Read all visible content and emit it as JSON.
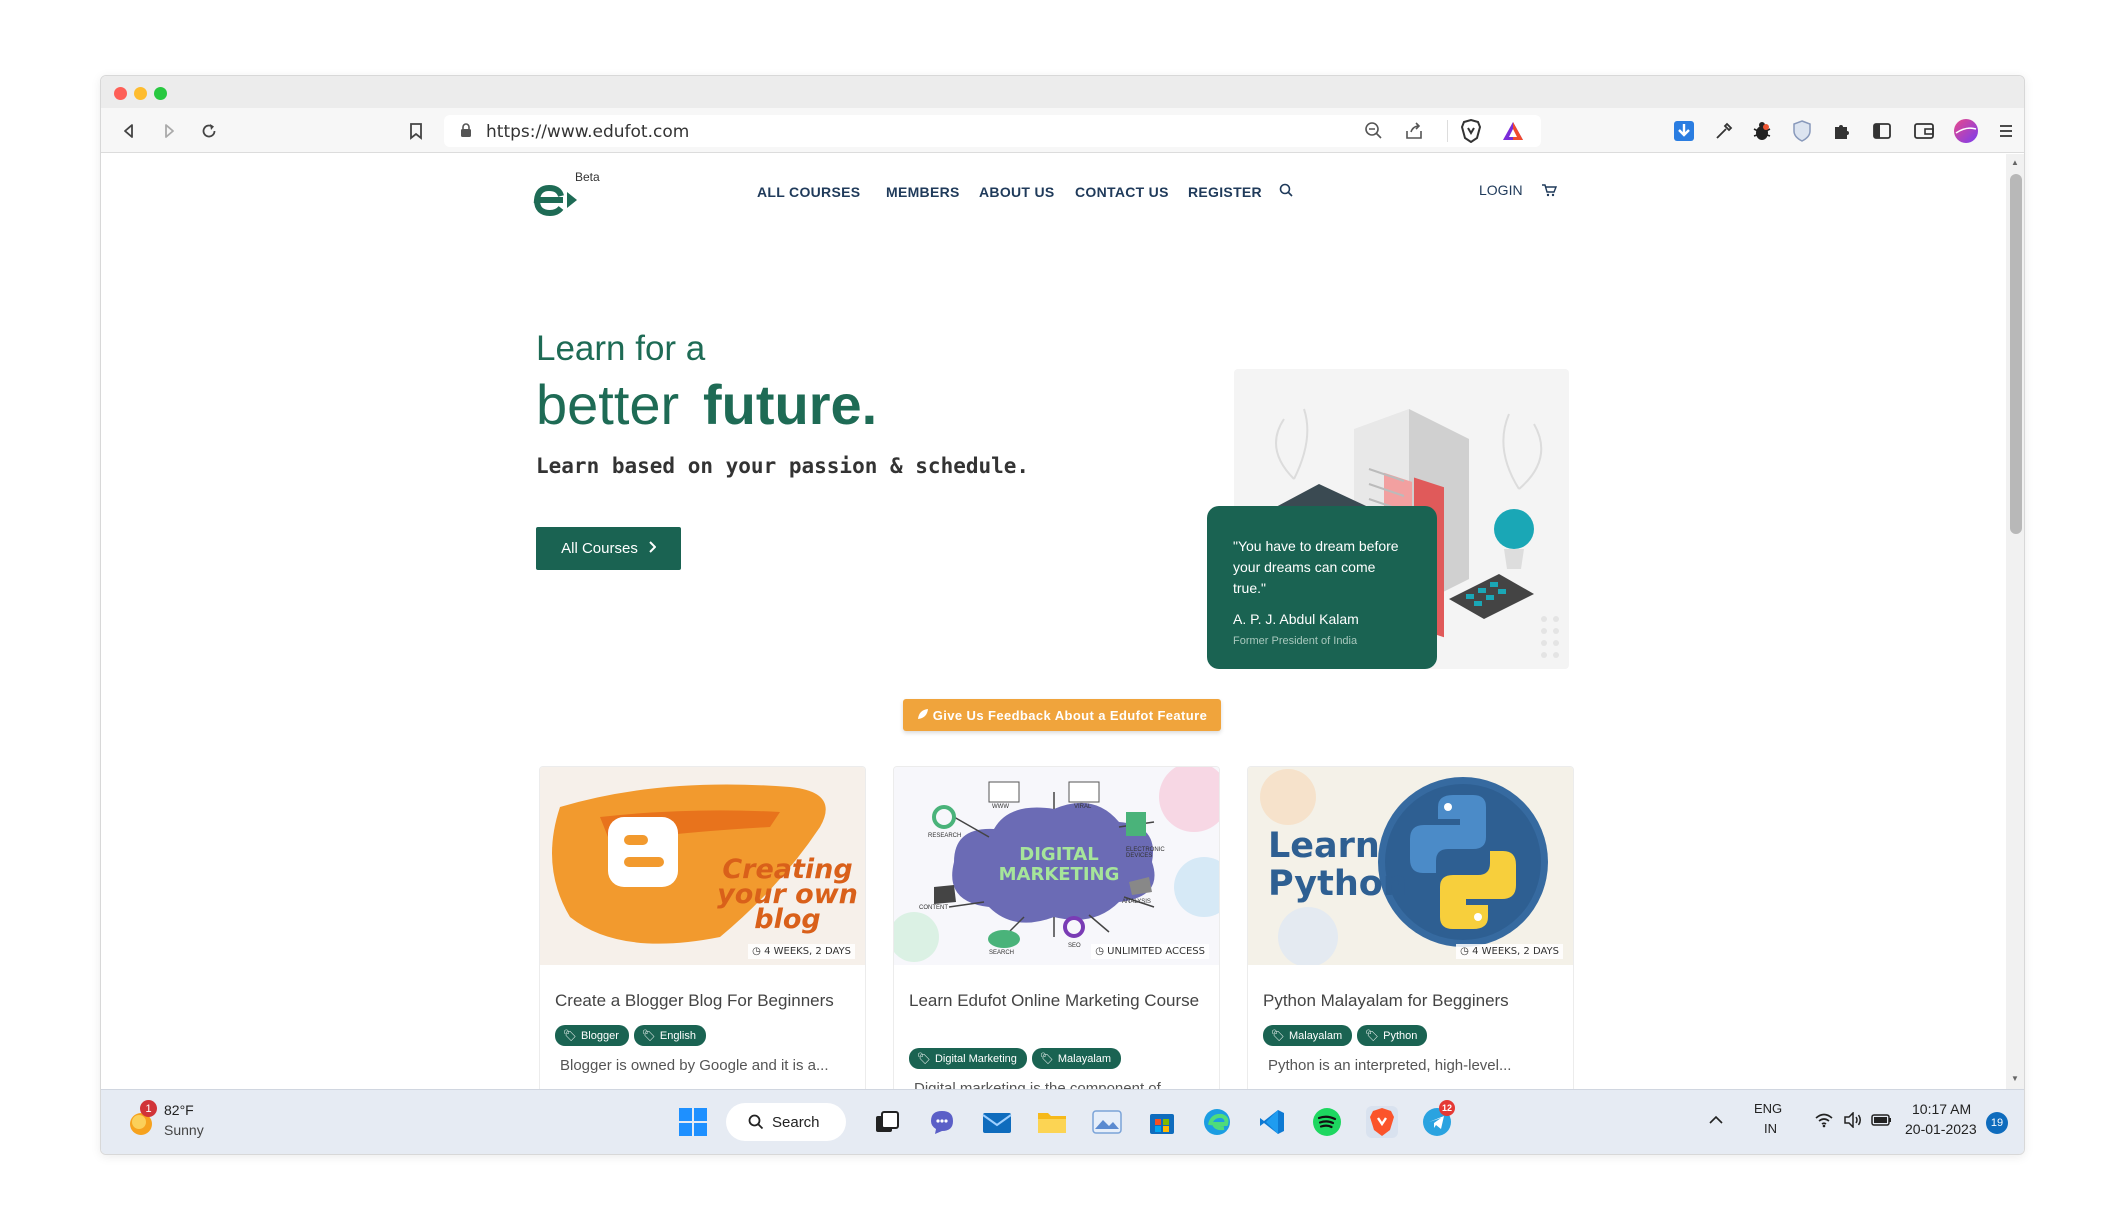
{
  "browser": {
    "url": "https://www.edufot.com"
  },
  "site": {
    "logo_badge": "Beta",
    "nav": [
      {
        "label": "ALL COURSES"
      },
      {
        "label": "MEMBERS"
      },
      {
        "label": "ABOUT US"
      },
      {
        "label": "CONTACT US"
      },
      {
        "label": "REGISTER"
      }
    ],
    "login": "LOGIN"
  },
  "hero": {
    "line1": "Learn for a",
    "line2_light": "better",
    "line2_bold": "future.",
    "subtitle": "Learn based on your passion & schedule.",
    "button": "All Courses"
  },
  "quote": {
    "text": "\"You have to dream before your dreams can come true.\"",
    "author": "A. P. J. Abdul Kalam",
    "role": "Former President of India"
  },
  "feedback": {
    "label": "Give Us Feedback About a Edufot Feature"
  },
  "courses": [
    {
      "image_text": "Creating your own blog",
      "duration": "4 WEEKS, 2 DAYS",
      "title": "Create a Blogger Blog For Beginners",
      "tags": [
        "Blogger",
        "English"
      ],
      "desc": "Blogger is owned by Google and it is a..."
    },
    {
      "image_text": "DIGITAL MARKETING",
      "image_labels": [
        "RESEARCH",
        "WWW",
        "VIRAL",
        "ELECTRONIC DEVICES",
        "CONTENT",
        "ANALYSIS",
        "SEARCH",
        "SEO"
      ],
      "duration": "UNLIMITED ACCESS",
      "title": "Learn Edufot Online Marketing Course",
      "tags": [
        "Digital Marketing",
        "Malayalam"
      ],
      "desc": "Digital marketing is the component of..."
    },
    {
      "image_text": "Learn Python",
      "duration": "4 WEEKS, 2 DAYS",
      "title": "Python Malayalam for Begginers",
      "tags": [
        "Malayalam",
        "Python"
      ],
      "desc": "Python is an interpreted, high-level..."
    }
  ],
  "taskbar": {
    "weather_temp": "82°F",
    "weather_cond": "Sunny",
    "weather_badge": "1",
    "search": "Search",
    "lang1": "ENG",
    "lang2": "IN",
    "time": "10:17 AM",
    "date": "20-01-2023",
    "notif_count": "19",
    "telegram_badge": "12"
  },
  "colors": {
    "brand_green": "#1a6352",
    "accent_orange": "#f0a43c"
  }
}
